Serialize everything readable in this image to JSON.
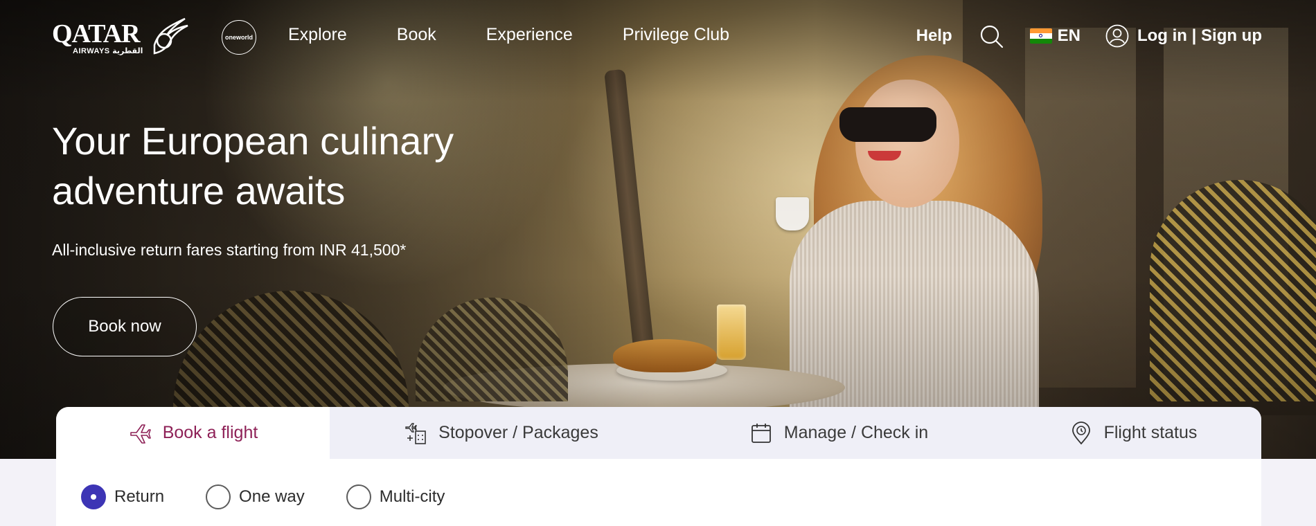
{
  "brand": {
    "logo_text": "QATAR",
    "logo_sub": "AIRWAYS القطرية",
    "alliance": "oneworld"
  },
  "nav": {
    "links": [
      "Explore",
      "Book",
      "Experience",
      "Privilege Club"
    ],
    "help": "Help",
    "language": "EN",
    "auth": "Log in | Sign up"
  },
  "hero": {
    "title_line1": "Your European culinary",
    "title_line2": "adventure awaits",
    "subtitle": "All-inclusive return fares starting from INR 41,500*",
    "cta": "Book now"
  },
  "booking": {
    "tabs": [
      {
        "label": "Book a flight",
        "icon": "plane-icon",
        "active": true
      },
      {
        "label": "Stopover / Packages",
        "icon": "stopover-icon",
        "active": false
      },
      {
        "label": "Manage / Check in",
        "icon": "calendar-icon",
        "active": false
      },
      {
        "label": "Flight status",
        "icon": "location-pin-icon",
        "active": false
      }
    ],
    "trip_types": [
      {
        "label": "Return",
        "selected": true
      },
      {
        "label": "One way",
        "selected": false
      },
      {
        "label": "Multi-city",
        "selected": false
      }
    ]
  },
  "colors": {
    "accent": "#8e2157",
    "radio_selected": "#3d35b5",
    "tab_inactive_bg": "#efeff7",
    "page_bg": "#f3f2f8"
  }
}
